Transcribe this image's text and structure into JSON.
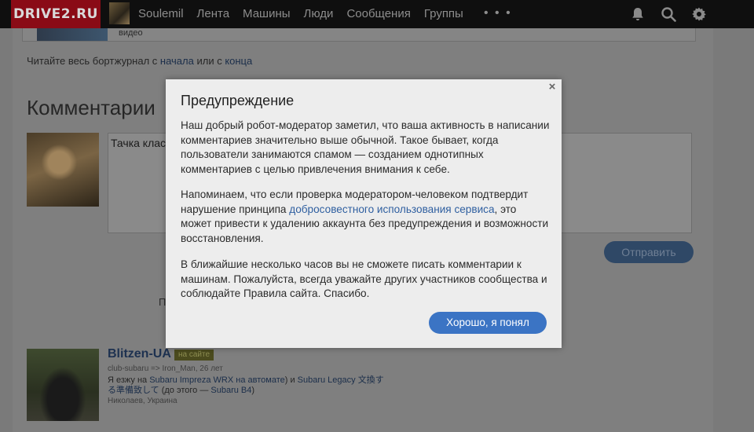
{
  "nav": {
    "logo": "DRIVE2.RU",
    "items": [
      "Soulemil",
      "Лента",
      "Машины",
      "Люди",
      "Сообщения",
      "Группы"
    ],
    "more": "• • •",
    "icons": [
      "bell-icon",
      "search-icon",
      "gear-icon"
    ]
  },
  "page": {
    "prev_caption": "видео",
    "read_prefix": "Читайте весь бортжурнал с ",
    "read_link_start": "начала",
    "read_middle": " или с ",
    "read_link_end": "конца",
    "comments_title": "Комментарии",
    "comment_value": "Тачка клас",
    "send_label": "Отправить",
    "partial_letter": "П"
  },
  "user": {
    "name": "Blitzen-UA",
    "badge": "на сайте",
    "meta": "club-subaru => Iron_Man, 26 лет",
    "about_prefix": "Я езжу на ",
    "about_car1": "Subaru Impreza WRX на автомате",
    "about_mid": ") и ",
    "about_car2": "Subaru Legacy 文換する準備致して",
    "about_tail": " (до этого — ",
    "about_car3": "Subaru B4",
    "about_end": ")",
    "location": "Николаев, Украина"
  },
  "modal": {
    "title": "Предупреждение",
    "close": "×",
    "p1": "Наш добрый робот-модератор заметил, что ваша активность в написании комментариев значительно выше обычной. Такое бывает, когда пользователи занимаются спамом — созданием однотипных комментариев с целью привлечения внимания к себе.",
    "p2_before": "Напоминаем, что если проверка модератором-человеком подтвердит нарушение принципа ",
    "p2_link": "добросовестного использования сервиса",
    "p2_after": ", это может привести к удалению аккаунта без предупреждения и возможности восстановления.",
    "p3": "В ближайшие несколько часов вы не сможете писать комментарии к машинам. Пожалуйста, всегда уважайте других участников сообщества и соблюдайте Правила сайта. Спасибо.",
    "ok_label": "Хорошо, я понял"
  },
  "colors": {
    "logo_bg": "#8a0b16",
    "primary_button": "#3b74c4",
    "link": "#2f5fa0"
  }
}
